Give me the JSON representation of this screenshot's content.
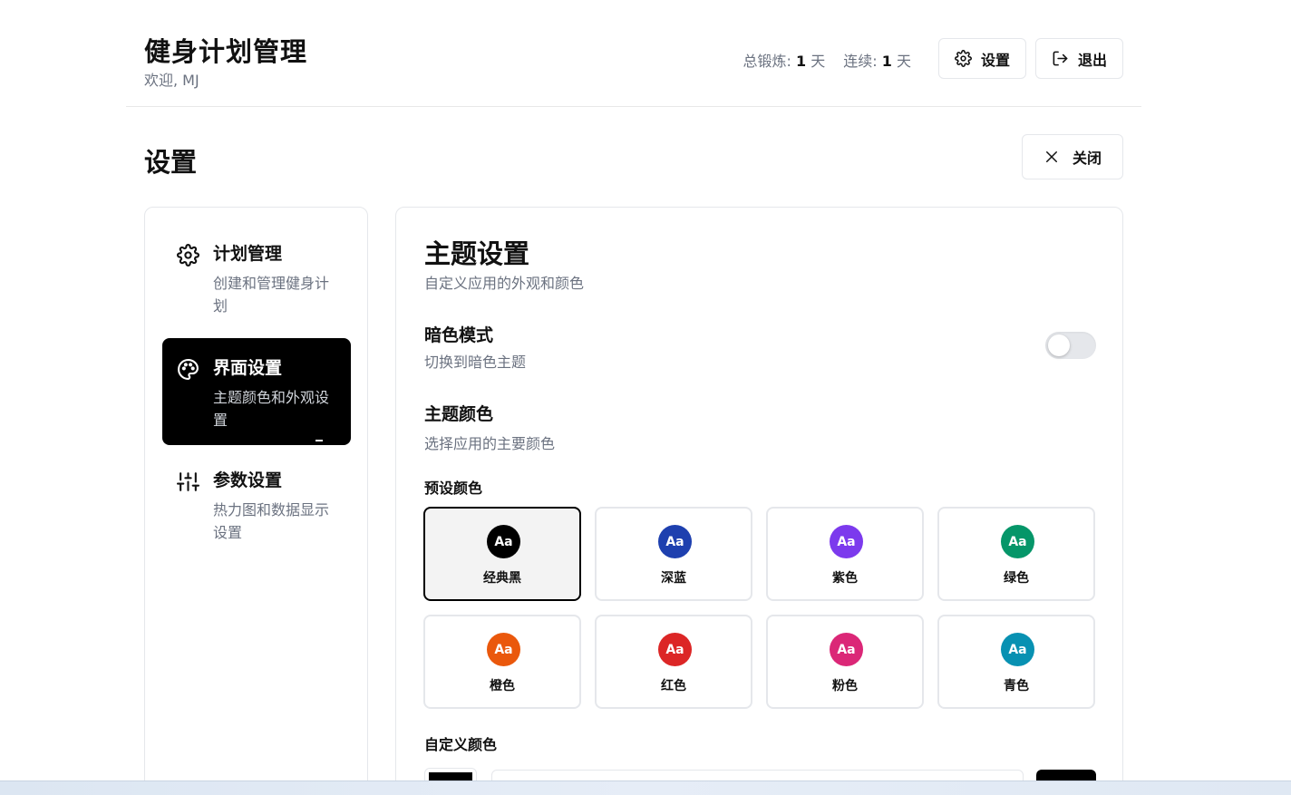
{
  "header": {
    "title": "健身计划管理",
    "welcome": "欢迎, MJ",
    "stats": {
      "total_label": "总锻炼:",
      "total_value": "1",
      "total_unit": "天",
      "streak_label": "连续:",
      "streak_value": "1",
      "streak_unit": "天"
    },
    "settings_button": "设置",
    "logout_button": "退出"
  },
  "page": {
    "title": "设置",
    "close_button": "关闭"
  },
  "sidebar": {
    "items": [
      {
        "title": "计划管理",
        "desc": "创建和管理健身计划",
        "icon": "gear-icon",
        "active": false
      },
      {
        "title": "界面设置",
        "desc": "主题颜色和外观设置",
        "icon": "palette-icon",
        "active": true
      },
      {
        "title": "参数设置",
        "desc": "热力图和数据显示设置",
        "icon": "sliders-icon",
        "active": false
      }
    ]
  },
  "theme": {
    "title": "主题设置",
    "desc": "自定义应用的外观和颜色",
    "dark_mode": {
      "label": "暗色模式",
      "desc": "切换到暗色主题",
      "enabled": false
    },
    "color": {
      "label": "主题颜色",
      "desc": "选择应用的主要颜色"
    },
    "presets_label": "预设颜色",
    "swatch_glyph": "Aa",
    "presets": [
      {
        "name": "经典黑",
        "color": "#000000",
        "selected": true
      },
      {
        "name": "深蓝",
        "color": "#1e40af",
        "selected": false
      },
      {
        "name": "紫色",
        "color": "#7c3aed",
        "selected": false
      },
      {
        "name": "绿色",
        "color": "#059669",
        "selected": false
      },
      {
        "name": "橙色",
        "color": "#ea580c",
        "selected": false
      },
      {
        "name": "红色",
        "color": "#dc2626",
        "selected": false
      },
      {
        "name": "粉色",
        "color": "#db2777",
        "selected": false
      },
      {
        "name": "青色",
        "color": "#0891b2",
        "selected": false
      }
    ],
    "custom_label": "自定义颜色",
    "custom_color": "#000000"
  }
}
